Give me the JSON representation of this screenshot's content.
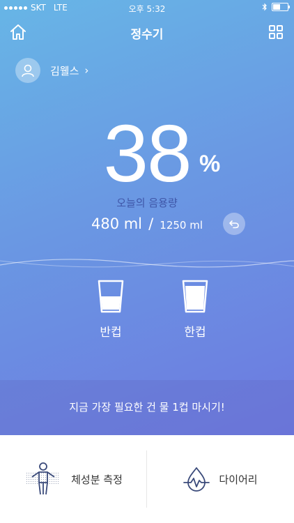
{
  "status_bar": {
    "carrier": "SKT",
    "network": "LTE",
    "time": "오후 5:32"
  },
  "nav": {
    "title": "정수기",
    "home_icon": "home-icon",
    "grid_icon": "grid-menu-icon"
  },
  "user": {
    "name": "김웰스",
    "chevron": "›"
  },
  "intake": {
    "percent": "38",
    "percent_sign": "%",
    "label": "오늘의 음용량",
    "current": "480 ml",
    "separator": "/",
    "goal": "1250 ml"
  },
  "cups": [
    {
      "label": "반컵",
      "fill_level": 0.5
    },
    {
      "label": "한컵",
      "fill_level": 0.85
    }
  ],
  "tip": "지금 가장 필요한 건 물 1컵 마시기!",
  "bottom": {
    "body_label": "체성분 측정",
    "diary_label": "다이어리"
  },
  "colors": {
    "gradient_top": "#67b6e6",
    "gradient_bottom": "#6d79e0",
    "label_dark_blue": "#3f56a8",
    "diary_icon": "#3a4a7a"
  }
}
